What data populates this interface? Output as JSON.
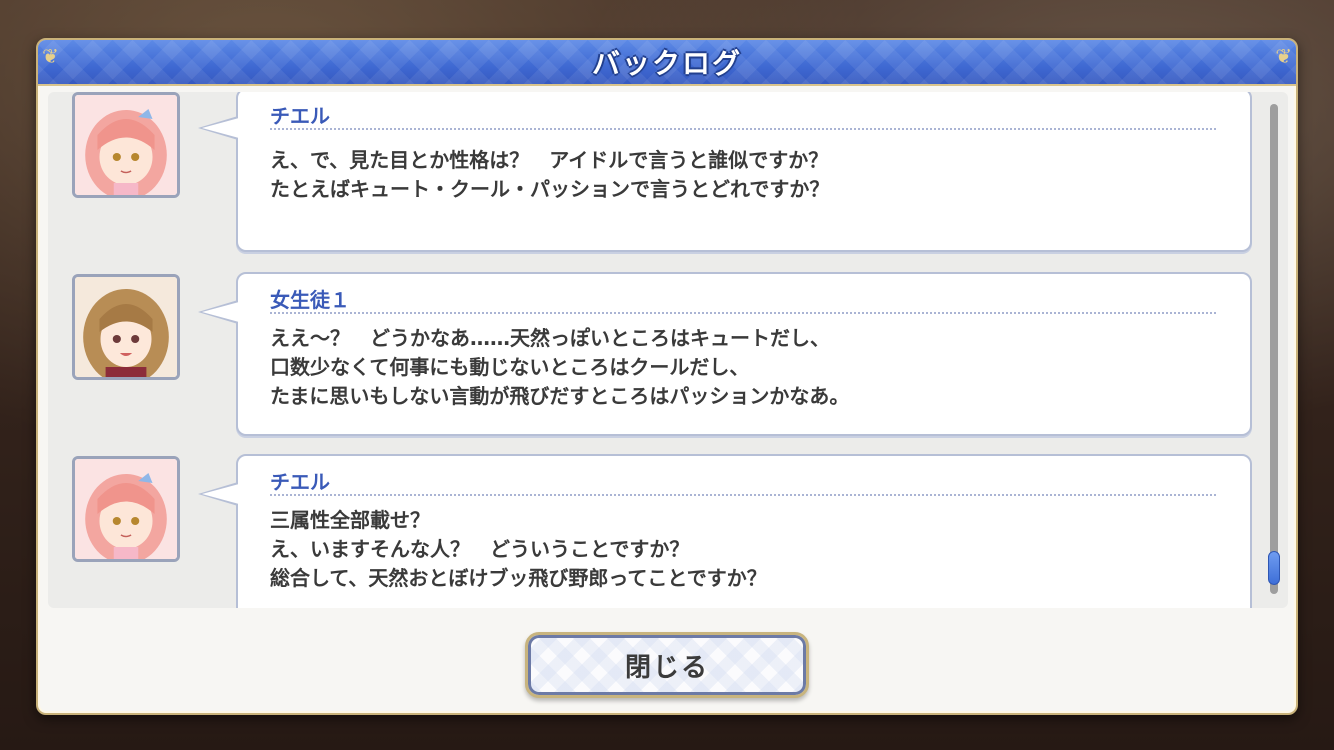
{
  "window": {
    "title": "バックログ"
  },
  "entries": [
    {
      "speaker": "チエル",
      "portrait_icon": "chieru-portrait",
      "lines": [
        "え、で、見た目とか性格は？　アイドルで言うと誰似ですか？",
        "たとえばキュート・クール・パッションで言うとどれですか？"
      ]
    },
    {
      "speaker": "女生徒１",
      "portrait_icon": "female-student-portrait",
      "lines": [
        "ええ～？　どうかなあ……天然っぽいところはキュートだし、",
        "口数少なくて何事にも動じないところはクールだし、",
        "たまに思いもしない言動が飛びだすところはパッションかなあ。"
      ]
    },
    {
      "speaker": "チエル",
      "portrait_icon": "chieru-portrait",
      "lines": [
        "三属性全部載せ？",
        "え、いますそんな人？　どういうことですか？",
        "総合して、天然おとぼけブッ飛び野郎ってことですか？"
      ]
    }
  ],
  "scroll": {
    "position": 0.98
  },
  "buttons": {
    "close_label": "閉じる"
  },
  "colors": {
    "title_bar": "#4a73d8",
    "speaker_name": "#3a5ab8",
    "body_text": "#3a3a3a",
    "frame_gold": "#c9b27a"
  }
}
